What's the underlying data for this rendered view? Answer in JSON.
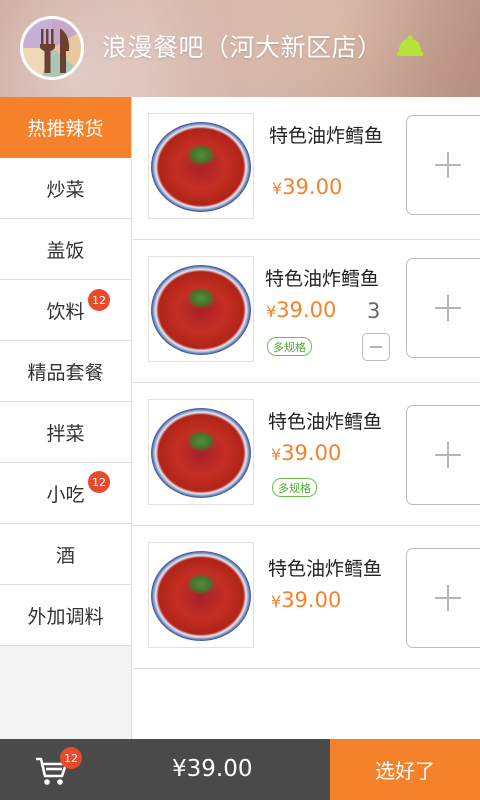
{
  "header": {
    "shop_name": "浪漫餐吧（河大新区店）",
    "logo_icon": "fork-knife-icon",
    "notice_icon": "bell-icon",
    "notice_color": "#b6e33a"
  },
  "sidebar": {
    "items": [
      {
        "label": "热推辣货",
        "active": true
      },
      {
        "label": "炒菜"
      },
      {
        "label": "盖饭"
      },
      {
        "label": "饮料",
        "badge": "12"
      },
      {
        "label": "精品套餐"
      },
      {
        "label": "拌菜"
      },
      {
        "label": "小吃",
        "badge": "12"
      },
      {
        "label": "酒"
      },
      {
        "label": "外加调料"
      }
    ]
  },
  "dishes": [
    {
      "name": "特色油炸鳕鱼",
      "currency": "¥",
      "price": "39.00"
    },
    {
      "name": "特色油炸鳕鱼",
      "currency": "¥",
      "price": "39.00",
      "tag": "多规格",
      "qty": "3"
    },
    {
      "name": "特色油炸鳕鱼",
      "currency": "¥",
      "price": "39.00",
      "tag": "多规格"
    },
    {
      "name": "特色油炸鳕鱼",
      "currency": "¥",
      "price": "39.00"
    }
  ],
  "bottom_bar": {
    "cart_icon": "cart-icon",
    "cart_badge": "12",
    "total": "¥39.00",
    "confirm_label": "选好了"
  },
  "colors": {
    "accent": "#f5822a",
    "badge": "#e84a2e",
    "bottom_bar": "#4a4a4a",
    "tag_green": "#6cc04a"
  }
}
